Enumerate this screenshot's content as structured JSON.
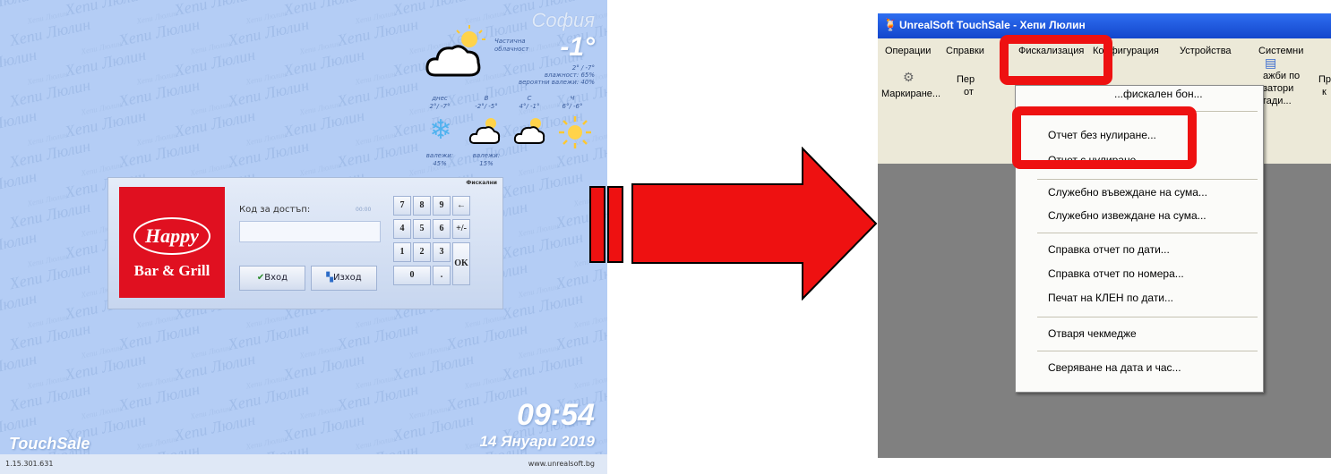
{
  "left": {
    "city": "София",
    "temperature": "-1°",
    "weather_desc": "Частична облачност",
    "range": "2° / -7°",
    "humidity": "влажност: 65%",
    "precip": "вероятни валежи: 40%",
    "forecast": [
      {
        "day": "днес",
        "range": "2°/ -7°",
        "rain": "валежи: 45%"
      },
      {
        "day": "В",
        "range": "-2°/ -5°",
        "rain": "валежи: 15%"
      },
      {
        "day": "С",
        "range": "4°/ -1°",
        "rain": ""
      },
      {
        "day": "Ч",
        "range": "6°/ -6°",
        "rain": ""
      }
    ],
    "watermark_text": "Хепи Люлин",
    "watermark_small": "Хепи Люлин",
    "login": {
      "title": "Фискални",
      "logo_script": "Happy",
      "logo_text": "Bar & Grill",
      "code_label": "Код за достъп:",
      "code_hint": "00:00",
      "code_placeholder": "",
      "enter_label": "Вход",
      "exit_label": "Изход",
      "keys": [
        "7",
        "8",
        "9",
        "←",
        "4",
        "5",
        "6",
        "+/-",
        "1",
        "2",
        "3",
        "OK",
        "0",
        "."
      ]
    },
    "clock": "09:54",
    "date": "14 Януари 2019",
    "brand": "TouchSale",
    "version": "1.15.301.631",
    "url": "www.unrealsoft.bg"
  },
  "right": {
    "window_title": "UnrealSoft TouchSale - Хепи Люлин",
    "menu": [
      "Операции",
      "Справки",
      "Фискализация",
      "Конфигурация",
      "Устройства",
      "Системни"
    ],
    "toolbar": {
      "marking_label": "Маркиране...",
      "partial_top": "Пер",
      "partial_bottom": "от",
      "right_a1": "ажби по",
      "right_a2": "затори",
      "right_a3": "гади...",
      "right_b1": "Пр",
      "right_b2": "к"
    },
    "dropdown_items": [
      "...фискален бон...",
      "Отчет без нулиране...",
      "Отчет с нулиране...",
      "Служебно въвеждане на сума...",
      "Служебно извеждане на сума...",
      "Справка отчет по дати...",
      "Справка отчет по номера...",
      "Печат на КЛЕН по дати...",
      "Отваря чекмедже",
      "Сверяване на дата и час..."
    ]
  },
  "colors": {
    "highlight": "#ee1111",
    "arrow": "#ee1111",
    "left_background": "#b4cdf5",
    "title_bar": "#1f5be0"
  }
}
